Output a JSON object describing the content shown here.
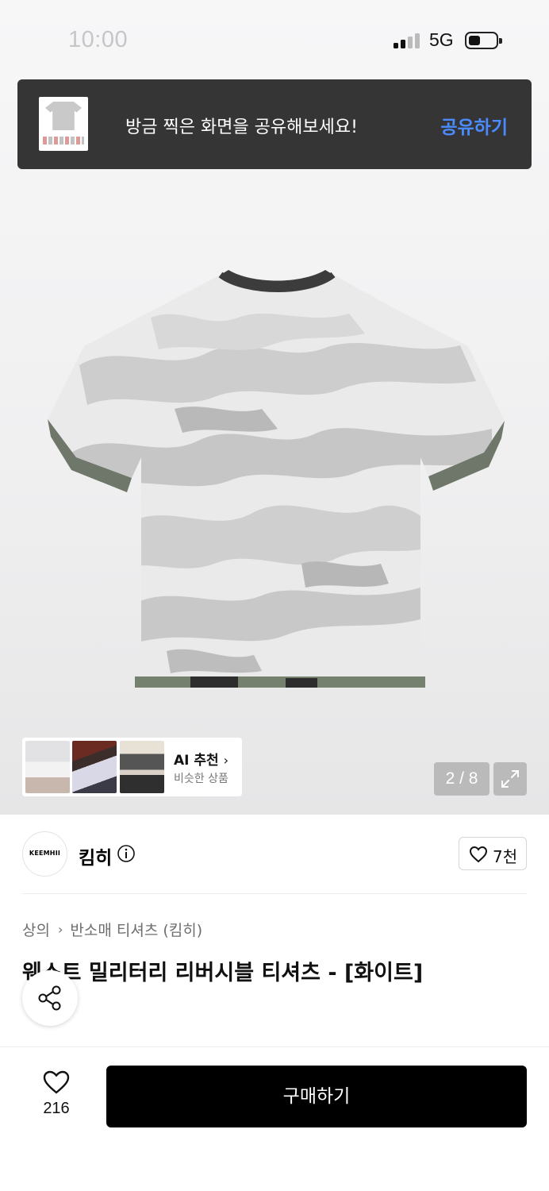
{
  "status_bar": {
    "time": "10:00",
    "network": "5G"
  },
  "toast": {
    "message": "방금 찍은 화면을 공유해보세요!",
    "action": "공유하기"
  },
  "gallery": {
    "counter": "2 / 8",
    "ai_recommend": {
      "title": "AI 추천",
      "subtitle": "비슷한 상품"
    }
  },
  "brand": {
    "logo_text": "KEEMHII",
    "name": "킴히",
    "like_count": "7천"
  },
  "product": {
    "breadcrumb": [
      "상의",
      "반소매 티셔츠 (킴히)"
    ],
    "title": "웨스트 밀리터리 리버시블 티셔츠 - [화이트]"
  },
  "bottom_bar": {
    "wishlist_count": "216",
    "buy_label": "구매하기"
  },
  "colors": {
    "toast_bg": "#353535",
    "toast_action": "#4a8cff",
    "buy_button": "#000000"
  }
}
